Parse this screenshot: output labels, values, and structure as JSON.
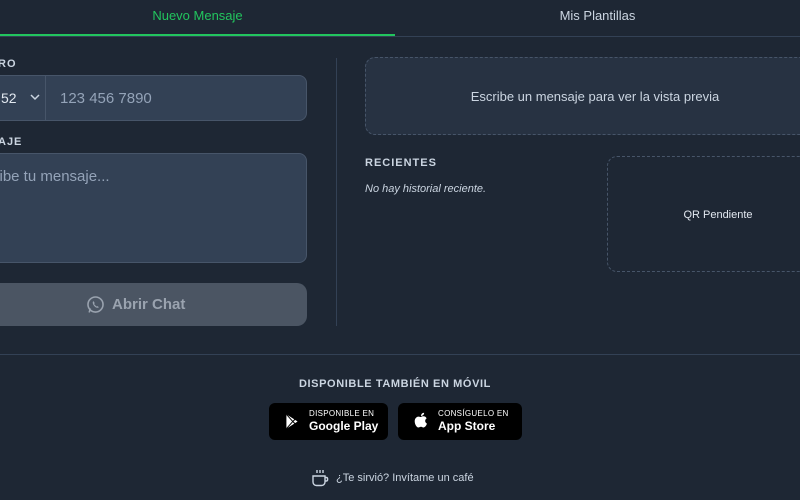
{
  "tabs": {
    "new_message": "Nuevo Mensaje",
    "templates": "Mis Plantillas"
  },
  "form": {
    "number_label": "RO",
    "country_code": "52",
    "phone_placeholder": "123 456 7890",
    "message_label": "AJE",
    "message_placeholder": "cribe tu mensaje...",
    "open_chat": "Abrir Chat"
  },
  "preview": {
    "placeholder": "Escribe un mensaje para ver la vista previa"
  },
  "recent": {
    "title": "RECIENTES",
    "empty": "No hay historial reciente."
  },
  "qr": {
    "status": "QR Pendiente"
  },
  "mobile": {
    "title": "DISPONIBLE TAMBIÉN EN MÓVIL",
    "google_small": "DISPONIBLE EN",
    "google_big": "Google Play",
    "apple_small": "CONSÍGUELO EN",
    "apple_big": "App Store"
  },
  "footer": {
    "coffee": "¿Te sirvió? Invítame un café"
  },
  "colors": {
    "accent": "#22c55e",
    "background": "#1e2734",
    "field": "#334155",
    "button_disabled": "#4b5563"
  }
}
